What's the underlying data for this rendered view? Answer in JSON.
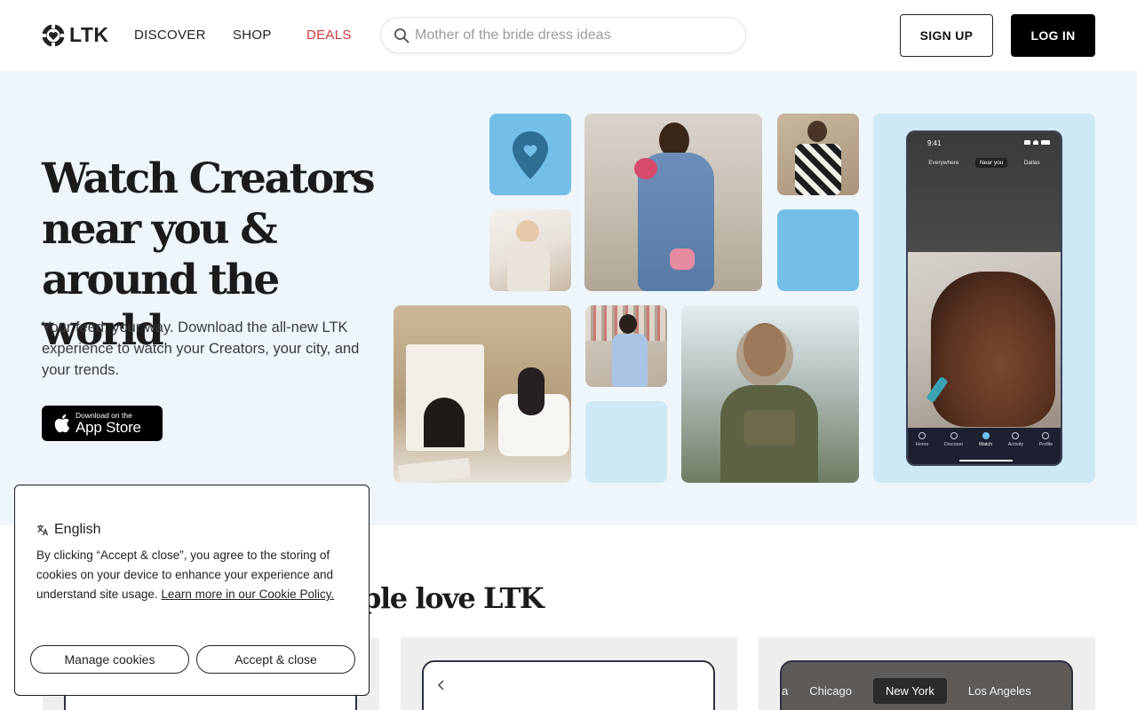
{
  "header": {
    "logo_text": "LTK",
    "nav": [
      {
        "label": "DISCOVER"
      },
      {
        "label": "SHOP"
      },
      {
        "label": "DEALS",
        "color": "#d0393e"
      }
    ],
    "search": {
      "placeholder": "Mother of the bride dress ideas",
      "value": ""
    },
    "signup_label": "SIGN UP",
    "login_label": "LOG IN"
  },
  "hero": {
    "title_lines": [
      "Watch Creators",
      "near you &",
      "around the world"
    ],
    "subtitle": "Your feed, your way. Download the all-new LTK experience to watch your Creators, your city, and your trends.",
    "appstore": {
      "small": "Download on the",
      "big": "App Store"
    },
    "background": "#eef6fc",
    "accent_blue": "#73bfe8",
    "pale_blue": "#cfe8f6",
    "phone": {
      "time": "9:41",
      "tabs": [
        "Everywhere",
        "Near you",
        "Dallas"
      ],
      "active_tab": "Near you",
      "bottom_nav": [
        "Home",
        "Discover",
        "Watch",
        "Activity",
        "Profile"
      ],
      "active_nav": "Watch"
    }
  },
  "section": {
    "title": "ple love LTK",
    "cities": [
      "a",
      "Chicago",
      "New York",
      "Los Angeles"
    ],
    "active_city": "New York"
  },
  "cookie": {
    "language": "English",
    "text": "By clicking “Accept & close”, you agree to the storing of cookies on your device to enhance your experience and understand site usage. ",
    "link": "Learn more in our Cookie Policy.",
    "manage_label": "Manage cookies",
    "accept_label": "Accept & close"
  }
}
